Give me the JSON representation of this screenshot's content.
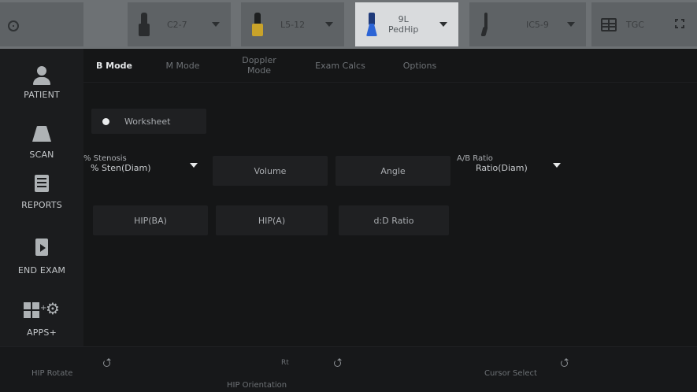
{
  "topbar": {
    "probes": [
      {
        "label": "C2-7",
        "icon": "curved-probe-icon"
      },
      {
        "label": "L5-12",
        "icon": "linear-probe-icon"
      },
      {
        "label": "9L",
        "label2": "PedHip",
        "icon": "linear-probe-icon",
        "active": true
      },
      {
        "label": "IC5-9",
        "icon": "endocavity-probe-icon"
      }
    ],
    "tgc_label": "TGC"
  },
  "sidebar": {
    "items": [
      {
        "label": "PATIENT"
      },
      {
        "label": "SCAN"
      },
      {
        "label": "REPORTS"
      },
      {
        "label": "END EXAM"
      },
      {
        "label": "APPS+"
      }
    ]
  },
  "tabs": [
    {
      "label": "B Mode",
      "active": true
    },
    {
      "label": "M Mode"
    },
    {
      "label": "Doppler Mode"
    },
    {
      "label": "Exam Calcs"
    },
    {
      "label": "Options"
    }
  ],
  "main": {
    "worksheet_label": "Worksheet",
    "stenosis": {
      "caption": "% Stenosis",
      "value": "% Sten(Diam)"
    },
    "volume_label": "Volume",
    "angle_label": "Angle",
    "ab_ratio": {
      "caption": "A/B Ratio",
      "value": "Ratio(Diam)"
    },
    "hip_ba_label": "HIP(BA)",
    "hip_a_label": "HIP(A)",
    "dd_ratio_label": "d:D Ratio"
  },
  "bottombar": {
    "hip_rotate": "HIP Rotate",
    "rt": "Rt",
    "hip_orientation": "HIP Orientation",
    "cursor_select": "Cursor Select"
  },
  "colors": {
    "topbar": "#6d7174",
    "active_probe": "#d9dbdd",
    "panel": "#151617",
    "button": "#1f2022",
    "probe_yellow": "#c9a32a",
    "probe_blue": "#2c64d6"
  }
}
